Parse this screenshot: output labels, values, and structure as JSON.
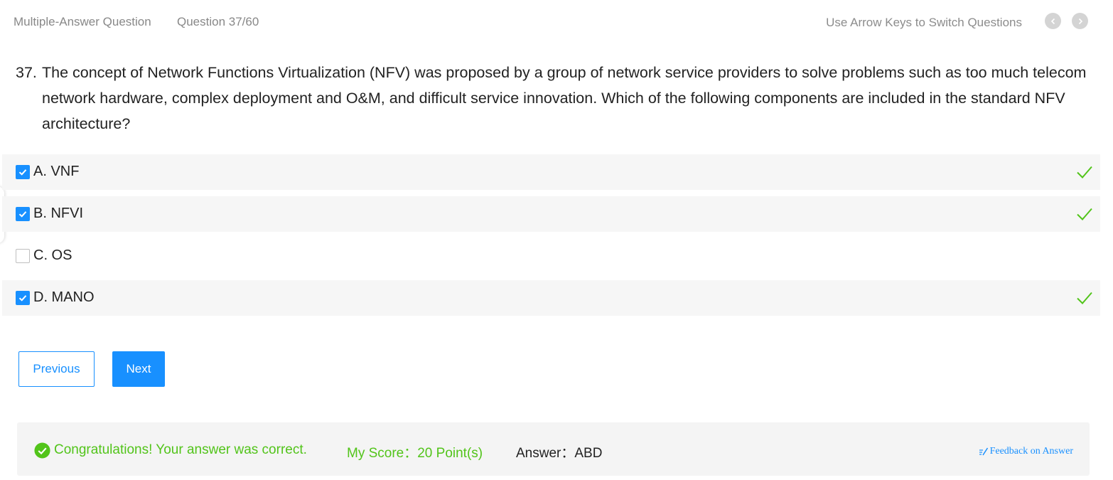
{
  "header": {
    "question_type": "Multiple-Answer Question",
    "question_counter": "Question 37/60",
    "hint": "Use Arrow Keys to Switch Questions",
    "prev_icon": "chevron-left-icon",
    "next_icon": "chevron-right-icon"
  },
  "question": {
    "number": "37.",
    "text": "The concept of Network Functions Virtualization (NFV) was proposed by a group of network service providers to solve problems such as too much telecom network hardware, complex deployment and O&M, and difficult service innovation. Which of the following components are included in the standard NFV architecture?"
  },
  "options": [
    {
      "label": "A. VNF",
      "checked": true,
      "correct": true
    },
    {
      "label": "B. NFVI",
      "checked": true,
      "correct": true
    },
    {
      "label": "C. OS",
      "checked": false,
      "correct": false
    },
    {
      "label": "D. MANO",
      "checked": true,
      "correct": true
    }
  ],
  "buttons": {
    "previous": "Previous",
    "next": "Next"
  },
  "result": {
    "message": "Congratulations! Your answer was correct.",
    "score": "My Score：20 Point(s)",
    "answer": "Answer：ABD",
    "feedback": "Feedback on Answer"
  },
  "colors": {
    "accent": "#1890ff",
    "success": "#52c41a",
    "option_shade": "#f6f6f6"
  }
}
